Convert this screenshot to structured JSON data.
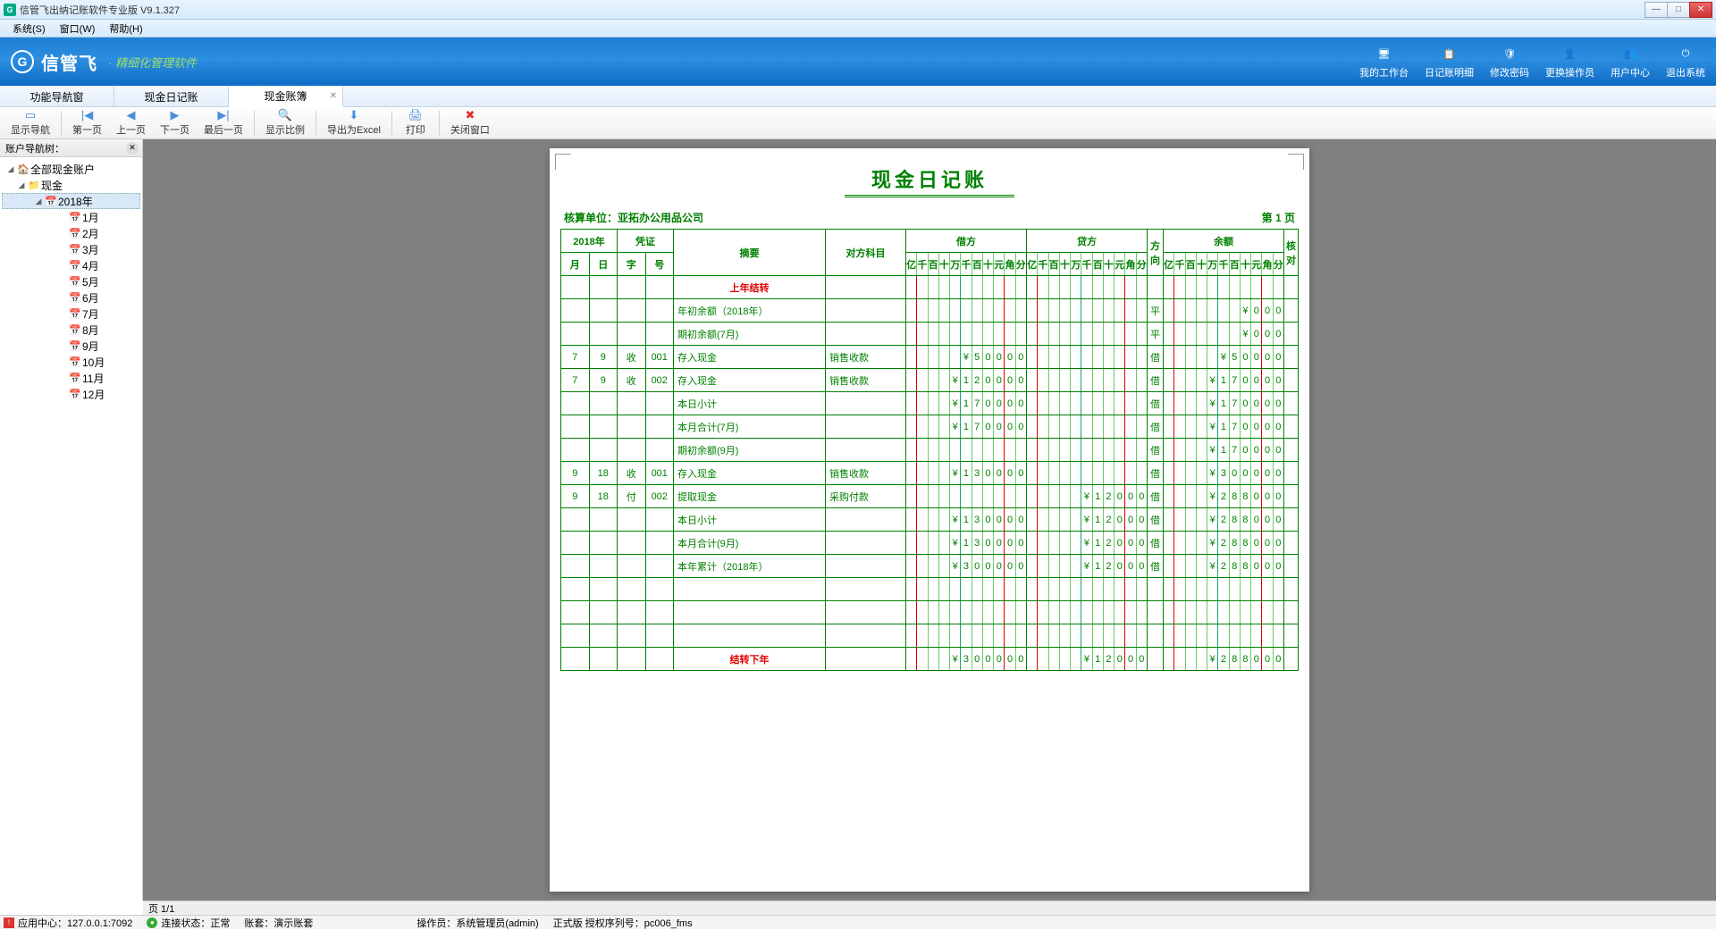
{
  "titlebar": {
    "title": "信管飞出纳记账软件专业版 V9.1.327"
  },
  "menu": {
    "system": "系统(S)",
    "window": "窗口(W)",
    "help": "帮助(H)"
  },
  "banner": {
    "brand": "信管飞",
    "subtitle": "· 精细化管理软件",
    "actions": [
      {
        "label": "我的工作台",
        "name": "my-workbench"
      },
      {
        "label": "日记账明细",
        "name": "journal-detail"
      },
      {
        "label": "修改密码",
        "name": "change-password"
      },
      {
        "label": "更换操作员",
        "name": "switch-operator"
      },
      {
        "label": "用户中心",
        "name": "user-center"
      },
      {
        "label": "退出系统",
        "name": "exit-system"
      }
    ]
  },
  "tabs": [
    {
      "label": "功能导航窗",
      "active": false,
      "closable": false
    },
    {
      "label": "现金日记账",
      "active": false,
      "closable": false
    },
    {
      "label": "现金账簿",
      "active": true,
      "closable": true
    }
  ],
  "toolbar": [
    {
      "label": "显示导航",
      "name": "show-nav",
      "icon": "▭"
    },
    {
      "label": "第一页",
      "name": "first-page",
      "icon": "|◀"
    },
    {
      "label": "上一页",
      "name": "prev-page",
      "icon": "◀"
    },
    {
      "label": "下一页",
      "name": "next-page",
      "icon": "▶"
    },
    {
      "label": "最后一页",
      "name": "last-page",
      "icon": "▶|"
    },
    {
      "label": "显示比例",
      "name": "zoom",
      "icon": "🔍"
    },
    {
      "label": "导出为Excel",
      "name": "export-excel",
      "icon": "⬇"
    },
    {
      "label": "打印",
      "name": "print",
      "icon": "🖨"
    },
    {
      "label": "关闭窗口",
      "name": "close-window",
      "icon": "✖",
      "red": true
    }
  ],
  "sidebar": {
    "title": "账户导航树：",
    "root": "全部现金账户",
    "group": "现金",
    "year": "2018年",
    "months": [
      "1月",
      "2月",
      "3月",
      "4月",
      "5月",
      "6月",
      "7月",
      "8月",
      "9月",
      "10月",
      "11月",
      "12月"
    ]
  },
  "ledger": {
    "title": "现金日记账",
    "unit_label": "核算单位：亚拓办公用品公司",
    "page_label": "第 1 页",
    "headers": {
      "year": "2018年",
      "month": "月",
      "day": "日",
      "voucher": "凭证",
      "voucher_word": "字",
      "voucher_no": "号",
      "summary": "摘要",
      "opposite": "对方科目",
      "debit": "借方",
      "credit": "贷方",
      "direction": "方向",
      "balance": "余额",
      "check": "核对",
      "digits": [
        "亿",
        "千",
        "百",
        "十",
        "万",
        "千",
        "百",
        "十",
        "元",
        "角",
        "分"
      ]
    },
    "rows": [
      {
        "type": "red",
        "summary": "上年结转"
      },
      {
        "summary": "年初余额（2018年）",
        "dir": "平",
        "balance": "¥000"
      },
      {
        "summary": "期初余额(7月)",
        "dir": "平",
        "balance": "¥000"
      },
      {
        "m": "7",
        "d": "9",
        "w": "收",
        "n": "001",
        "summary": "存入现金",
        "opp": "销售收款",
        "debit": "¥50000",
        "dir": "借",
        "balance": "¥50000"
      },
      {
        "m": "7",
        "d": "9",
        "w": "收",
        "n": "002",
        "summary": "存入现金",
        "opp": "销售收款",
        "debit": "¥120000",
        "dir": "借",
        "balance": "¥170000"
      },
      {
        "summary": "本日小计",
        "debit": "¥170000",
        "dir": "借",
        "balance": "¥170000"
      },
      {
        "summary": "本月合计(7月)",
        "debit": "¥170000",
        "dir": "借",
        "balance": "¥170000"
      },
      {
        "summary": "期初余额(9月)",
        "dir": "借",
        "balance": "¥170000"
      },
      {
        "m": "9",
        "d": "18",
        "w": "收",
        "n": "001",
        "summary": "存入现金",
        "opp": "销售收款",
        "debit": "¥130000",
        "dir": "借",
        "balance": "¥300000"
      },
      {
        "m": "9",
        "d": "18",
        "w": "付",
        "n": "002",
        "summary": "提取现金",
        "opp": "采购付款",
        "credit": "¥12000",
        "dir": "借",
        "balance": "¥288000"
      },
      {
        "summary": "本日小计",
        "debit": "¥130000",
        "credit": "¥12000",
        "dir": "借",
        "balance": "¥288000"
      },
      {
        "summary": "本月合计(9月)",
        "debit": "¥130000",
        "credit": "¥12000",
        "dir": "借",
        "balance": "¥288000"
      },
      {
        "summary": "本年累计（2018年）",
        "debit": "¥300000",
        "credit": "¥12000",
        "dir": "借",
        "balance": "¥288000"
      },
      {
        "type": "blank"
      },
      {
        "type": "blank"
      },
      {
        "type": "blank"
      },
      {
        "type": "red",
        "summary": "结转下年",
        "debit": "¥300000",
        "credit": "¥12000",
        "balance": "¥288000"
      }
    ]
  },
  "page_status": "页 1/1",
  "statusbar": {
    "app_center": "应用中心：127.0.0.1:7092",
    "conn": "连接状态：正常",
    "book": "账套：演示账套",
    "operator": "操作员：系统管理员(admin)",
    "license": "正式版 授权序列号：pc006_fms"
  }
}
